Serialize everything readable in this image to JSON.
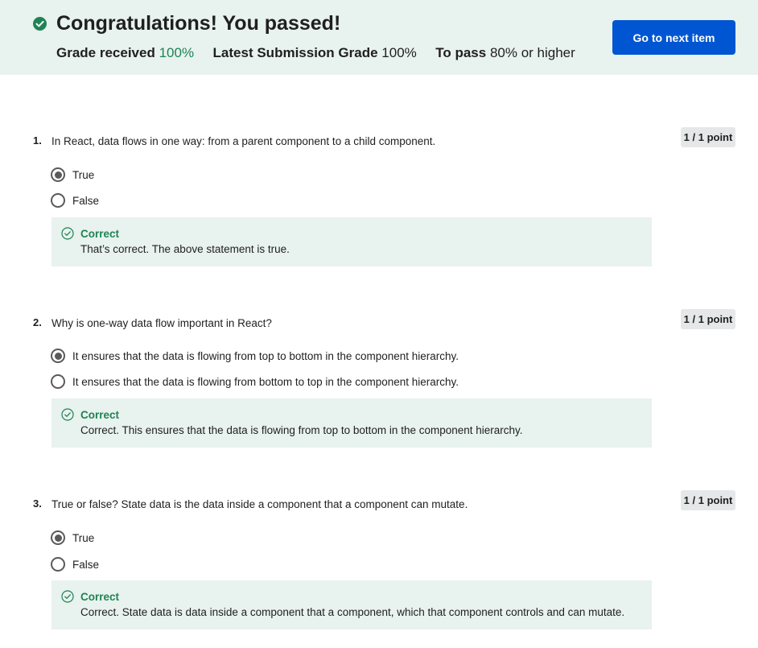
{
  "banner": {
    "title": "Congratulations! You passed!",
    "grade_received_label": "Grade received",
    "grade_received_value": "100%",
    "latest_label": "Latest Submission Grade",
    "latest_value": "100%",
    "to_pass_label": "To pass",
    "to_pass_value": "80% or higher",
    "next_button": "Go to next item"
  },
  "questions": [
    {
      "number": "1.",
      "text": "In React, data flows in one way: from a parent component to a child component.",
      "points": "1 / 1 point",
      "options": [
        {
          "label": "True",
          "selected": true
        },
        {
          "label": "False",
          "selected": false
        }
      ],
      "feedback_title": "Correct",
      "feedback_text": "That’s correct. The above statement is true."
    },
    {
      "number": "2.",
      "text": "Why is one-way data flow important in React?",
      "points": "1 / 1 point",
      "options": [
        {
          "label": "It ensures that the data is flowing from top to bottom in the component hierarchy.",
          "selected": true
        },
        {
          "label": "It ensures that the data is flowing from bottom to top in the component hierarchy.",
          "selected": false
        }
      ],
      "feedback_title": "Correct",
      "feedback_text": "Correct. This ensures that the data is flowing from top to bottom in the component hierarchy."
    },
    {
      "number": "3.",
      "text": "True or false? State data is the data inside a component that a component can mutate.",
      "points": "1 / 1 point",
      "options": [
        {
          "label": "True",
          "selected": true
        },
        {
          "label": "False",
          "selected": false
        }
      ],
      "feedback_title": "Correct",
      "feedback_text": "Correct. State data is data inside a component that a component, which that component controls and can mutate."
    }
  ],
  "colors": {
    "success_green": "#1f8354",
    "banner_bg": "#e8f2ee",
    "button_blue": "#0056d2"
  }
}
